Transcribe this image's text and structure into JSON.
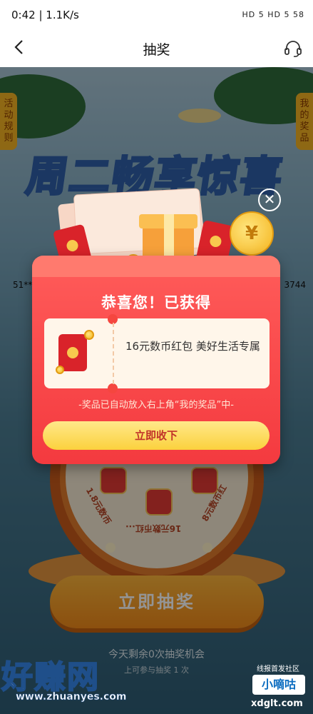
{
  "status_bar": {
    "time_speed": "0:42 | 1.1K/s",
    "right_indicators": "HD 5 HD 5 58"
  },
  "header": {
    "title": "抽奖"
  },
  "background": {
    "hero_title": "周二畅享惊喜",
    "rules_tab": "活动规则",
    "prizes_tab": "我的奖品",
    "ticker_left": "51**",
    "ticker_right": "3744",
    "wheel_segments": [
      "1.8元数币",
      "16元数币红...",
      "8元数币红"
    ],
    "draw_button": "立即抽奖",
    "remaining_text": "今天剩余0次抽奖机会",
    "info_text": "上可参与抽奖 1 次"
  },
  "modal": {
    "close_symbol": "✕",
    "congrats": "恭喜您！已获得",
    "prize_name": "16元数币红包 美好生活专属",
    "notice": "-奖品已自动放入右上角“我的奖品”中-",
    "collect_button": "立即收下",
    "coin_symbol": "¥"
  },
  "watermarks": {
    "left_brand": "好赚网",
    "left_url": "www.zhuanyes.com",
    "right_tagline": "线报首发社区",
    "right_brand": "小嘀咕",
    "right_url": "xdglt.com"
  }
}
